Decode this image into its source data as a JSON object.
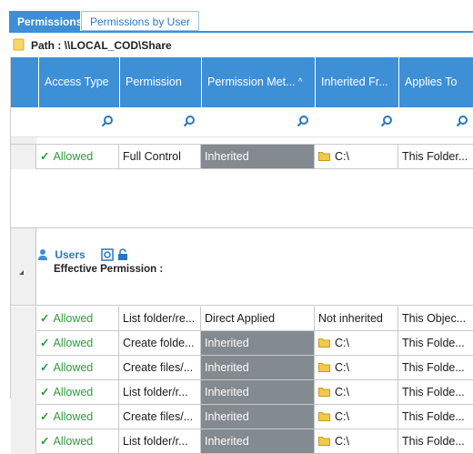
{
  "tabs": [
    {
      "label": "Permissions",
      "active": true
    },
    {
      "label": "Permissions by User",
      "active": false
    }
  ],
  "path": {
    "text": "Path : \\\\LOCAL_COD\\Share"
  },
  "columns": [
    "Access Type",
    "Permission",
    "Permission Met...",
    "Inherited Fr...",
    "Applies To"
  ],
  "sort_column": "Permission Met...",
  "top_row": {
    "access": "Allowed",
    "permission": "Full Control",
    "method": "Inherited",
    "inherited_from": "C:\\",
    "applies_to": "This Folder..."
  },
  "group": {
    "title": "Users",
    "subtitle": "Effective Permission :"
  },
  "rows": [
    {
      "access": "Allowed",
      "permission": "List folder/re...",
      "method": "Direct Applied",
      "inherited_from": "Not inherited",
      "applies_to": "This Objec..."
    },
    {
      "access": "Allowed",
      "permission": "Create folde...",
      "method": "Inherited",
      "inherited_from": "C:\\",
      "applies_to": "This Folde..."
    },
    {
      "access": "Allowed",
      "permission": "Create files/...",
      "method": "Inherited",
      "inherited_from": "C:\\",
      "applies_to": "This Folde..."
    },
    {
      "access": "Allowed",
      "permission": "List folder/r...",
      "method": "Inherited",
      "inherited_from": "C:\\",
      "applies_to": "This Folde..."
    },
    {
      "access": "Allowed",
      "permission": "Create files/...",
      "method": "Inherited",
      "inherited_from": "C:\\",
      "applies_to": "This Folde..."
    },
    {
      "access": "Allowed",
      "permission": "List folder/r...",
      "method": "Inherited",
      "inherited_from": "C:\\",
      "applies_to": "This Folde..."
    }
  ],
  "colors": {
    "header": "#3d8fd6",
    "allowed": "#2e9b3c",
    "inherited_bg": "#838a90"
  }
}
